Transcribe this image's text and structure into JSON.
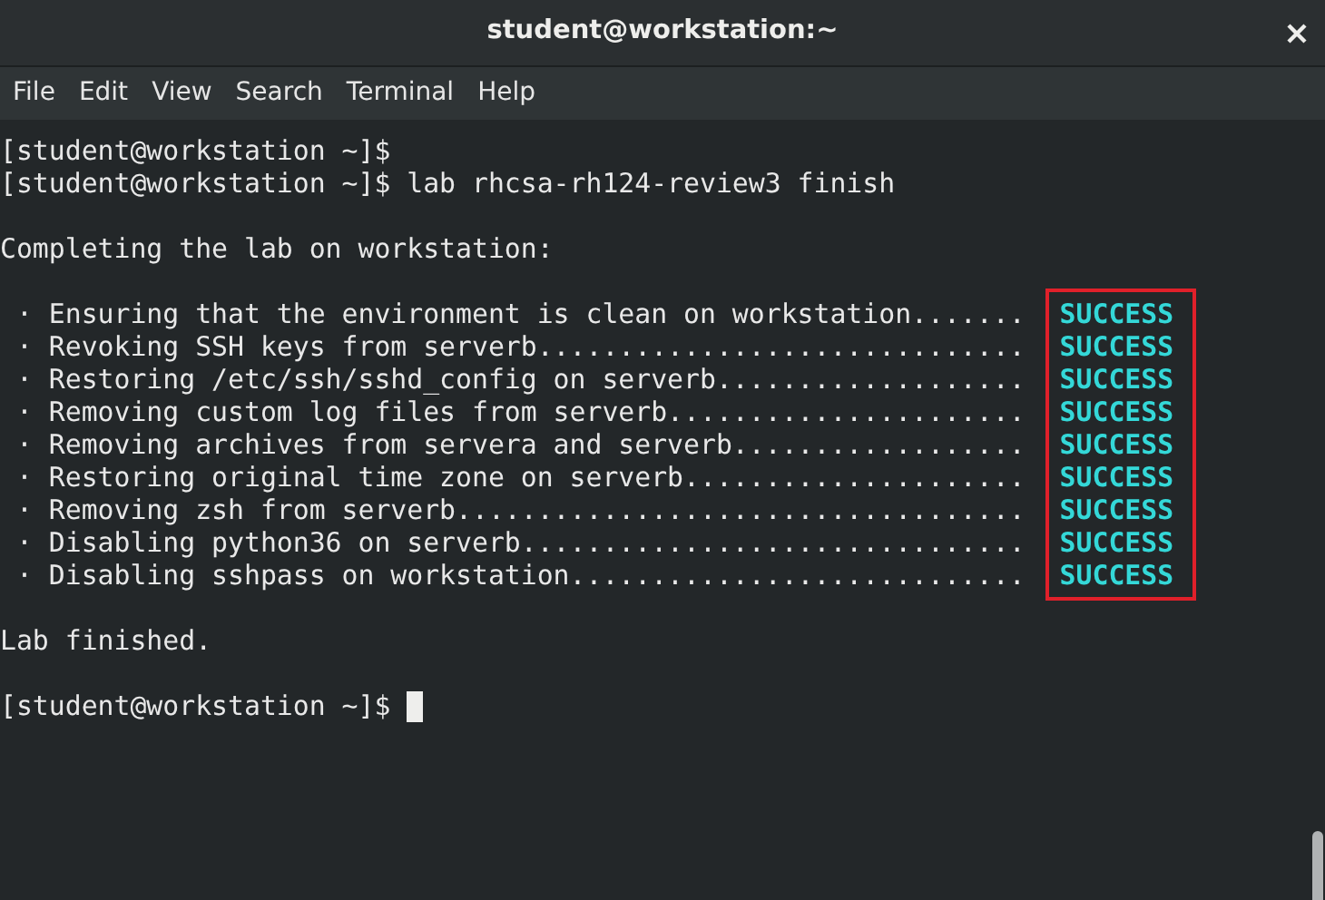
{
  "window": {
    "title": "student@workstation:~"
  },
  "menu": [
    "File",
    "Edit",
    "View",
    "Search",
    "Terminal",
    "Help"
  ],
  "terminal": [
    {
      "kind": "prompt",
      "text": "[student@workstation ~]$",
      "cursor": false
    },
    {
      "kind": "prompt",
      "text": "[student@workstation ~]$ lab rhcsa-rh124-review3 finish",
      "cursor": false
    },
    {
      "kind": "blank"
    },
    {
      "kind": "text",
      "text": "Completing the lab on workstation:"
    },
    {
      "kind": "blank"
    },
    {
      "kind": "tasks",
      "items": [
        {
          "text": " · Ensuring that the environment is clean on workstation.......",
          "status": "SUCCESS"
        },
        {
          "text": " · Revoking SSH keys from serverb..............................",
          "status": "SUCCESS"
        },
        {
          "text": " · Restoring /etc/ssh/sshd_config on serverb...................",
          "status": "SUCCESS"
        },
        {
          "text": " · Removing custom log files from serverb......................",
          "status": "SUCCESS"
        },
        {
          "text": " · Removing archives from servera and serverb..................",
          "status": "SUCCESS"
        },
        {
          "text": " · Restoring original time zone on serverb.....................",
          "status": "SUCCESS"
        },
        {
          "text": " · Removing zsh from serverb...................................",
          "status": "SUCCESS"
        },
        {
          "text": " · Disabling python36 on serverb...............................",
          "status": "SUCCESS"
        },
        {
          "text": " · Disabling sshpass on workstation............................",
          "status": "SUCCESS"
        }
      ]
    },
    {
      "kind": "blank"
    },
    {
      "kind": "text",
      "text": "Lab finished."
    },
    {
      "kind": "blank"
    },
    {
      "kind": "prompt",
      "text": "[student@workstation ~]$",
      "cursor": true
    }
  ]
}
